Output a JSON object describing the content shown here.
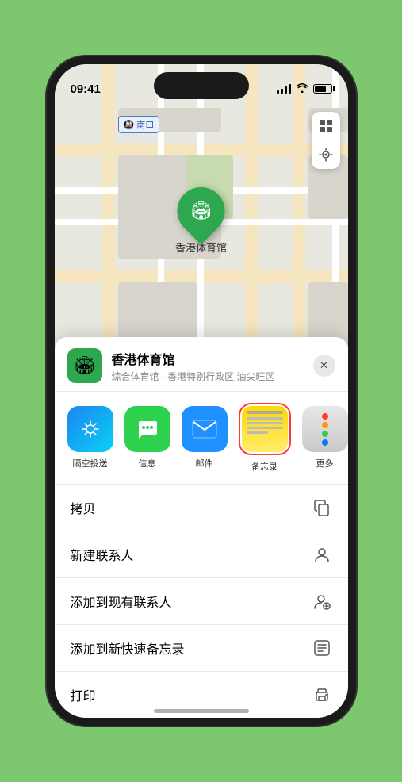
{
  "status": {
    "time": "09:41",
    "time_arrow": "▶"
  },
  "map": {
    "location_label": "南口",
    "pin_label": "香港体育馆",
    "controls": {
      "map_icon": "🗺",
      "location_icon": "◎"
    }
  },
  "sheet": {
    "venue_name": "香港体育馆",
    "venue_desc": "综合体育馆 · 香港特别行政区 油尖旺区",
    "close_label": "✕"
  },
  "share_items": [
    {
      "key": "airdrop",
      "label": "隔空投送",
      "icon": "airdrop"
    },
    {
      "key": "messages",
      "label": "信息",
      "icon": "messages"
    },
    {
      "key": "mail",
      "label": "邮件",
      "icon": "mail"
    },
    {
      "key": "notes",
      "label": "备忘录",
      "icon": "notes"
    }
  ],
  "actions": [
    {
      "key": "copy",
      "label": "拷贝",
      "icon": "copy"
    },
    {
      "key": "new-contact",
      "label": "新建联系人",
      "icon": "person"
    },
    {
      "key": "add-contact",
      "label": "添加到现有联系人",
      "icon": "person-add"
    },
    {
      "key": "quick-note",
      "label": "添加到新快速备忘录",
      "icon": "note"
    },
    {
      "key": "print",
      "label": "打印",
      "icon": "print"
    }
  ]
}
